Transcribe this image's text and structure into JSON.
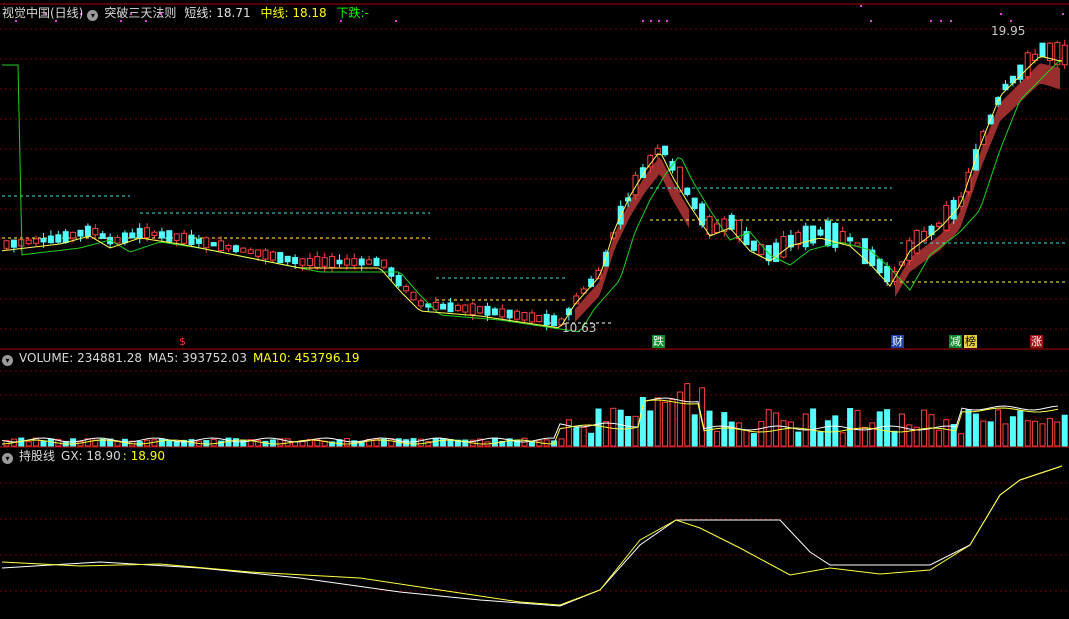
{
  "main_panel": {
    "title": "视觉中国(日线)",
    "indicator_name": "突破三天法则",
    "short_label": "短线:",
    "short_value": "18.71",
    "mid_label": "中线:",
    "mid_value": "18.18",
    "down_label": "下跌:",
    "down_value": "-",
    "high_label": "19.95",
    "low_label": "10.63",
    "colors": {
      "up": "#ff4040",
      "down": "#54ffff",
      "ma_short": "#ffff55",
      "ma_mid": "#ffffff",
      "band": "#9a2e2e",
      "grid": "#7a0000"
    }
  },
  "event_markers": [
    {
      "label": "$",
      "color": "#ff3030",
      "bg": "none"
    },
    {
      "label": "跌",
      "color": "#ffffff",
      "bg": "#0e8a2a"
    },
    {
      "label": "财",
      "color": "#ffffff",
      "bg": "#1d3fa8"
    },
    {
      "label": "减",
      "color": "#ffffff",
      "bg": "#0e8a2a"
    },
    {
      "label": "榜",
      "color": "#000000",
      "bg": "#e8d040"
    },
    {
      "label": "涨",
      "color": "#ffffff",
      "bg": "#a01010"
    }
  ],
  "volume_panel": {
    "label": "VOLUME: 234881.28",
    "ma5": "MA5: 393752.03",
    "ma10": "MA10: 453796.19"
  },
  "gx_panel": {
    "name": "持股线",
    "gx_label": "GX: 18.90",
    "gx_value": ": 18.90"
  }
}
